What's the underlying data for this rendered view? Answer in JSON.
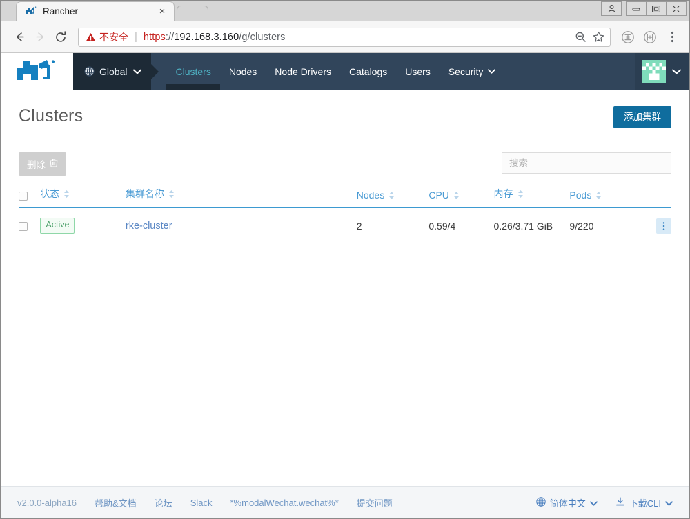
{
  "browser": {
    "tab": {
      "title": "Rancher",
      "favicon": "rancher-cow-icon",
      "close_label": "×"
    },
    "window_controls": {
      "profile": "person-icon",
      "minimize": "minimize-icon",
      "maximize": "maximize-icon",
      "close": "close-icon"
    },
    "toolbar": {
      "back": "back-arrow-icon",
      "forward": "forward-arrow-icon",
      "reload": "reload-icon",
      "security_label": "不安全",
      "security_icon": "warning-triangle-icon",
      "url_scheme": "https",
      "url_colon": "://",
      "url_host": "192.168.3.160",
      "url_path": "/g/clusters",
      "zoom_out_icon": "zoom-out-icon",
      "bookmark_icon": "star-icon",
      "extension_one": "extension-icon",
      "extension_two": "extension-icon",
      "menu_icon": "three-dot-menu-icon"
    }
  },
  "nav": {
    "logo": "rancher-cow-logo",
    "context": {
      "label": "Global",
      "icon": "globe-icon",
      "caret": "chevron-down-icon"
    },
    "links": [
      {
        "label": "Clusters",
        "active": true,
        "caret": false
      },
      {
        "label": "Nodes",
        "active": false,
        "caret": false
      },
      {
        "label": "Node Drivers",
        "active": false,
        "caret": false
      },
      {
        "label": "Catalogs",
        "active": false,
        "caret": false
      },
      {
        "label": "Users",
        "active": false,
        "caret": false
      },
      {
        "label": "Security",
        "active": false,
        "caret": true
      }
    ],
    "avatar": "user-identicon-avatar",
    "avatar_caret": "chevron-down-icon"
  },
  "page": {
    "title": "Clusters",
    "add_button": "添加集群"
  },
  "table_tools": {
    "delete_label": "删除",
    "delete_icon": "trash-icon",
    "search_placeholder": "搜索",
    "search_value": ""
  },
  "table": {
    "columns": [
      {
        "key": "state",
        "label": "状态",
        "sortable": true
      },
      {
        "key": "name",
        "label": "集群名称",
        "sortable": true
      },
      {
        "key": "nodes",
        "label": "Nodes",
        "sortable": true
      },
      {
        "key": "cpu",
        "label": "CPU",
        "sortable": true
      },
      {
        "key": "memory",
        "label": "内存",
        "sortable": true
      },
      {
        "key": "pods",
        "label": "Pods",
        "sortable": true
      }
    ],
    "rows": [
      {
        "state": "Active",
        "name": "rke-cluster",
        "nodes": "2",
        "cpu": "0.59/4",
        "memory": "0.26/3.71 GiB",
        "pods": "9/220",
        "actions_icon": "vertical-dots-icon"
      }
    ]
  },
  "footer": {
    "links": [
      {
        "label": "v2.0.0-alpha16",
        "kind": "version"
      },
      {
        "label": "帮助&文档",
        "kind": "link"
      },
      {
        "label": "论坛",
        "kind": "link"
      },
      {
        "label": "Slack",
        "kind": "link"
      },
      {
        "label": "*%modalWechat.wechat%*",
        "kind": "link"
      },
      {
        "label": "提交问题",
        "kind": "link"
      }
    ],
    "language": {
      "label": "简体中文",
      "icon": "globe-icon",
      "caret": "chevron-down-icon"
    },
    "cli": {
      "label": "下载CLI",
      "icon": "download-icon",
      "caret": "chevron-down-icon"
    }
  },
  "colors": {
    "nav_bg": "#31455b",
    "nav_context_bg": "#1d2a36",
    "accent_blue": "#0f6d9e",
    "link_blue": "#5a87c4",
    "active_tab": "#4fb2c4",
    "header_blue": "#4a9bd4",
    "badge_green": "#4a9e68",
    "danger_red": "#c5221f"
  }
}
